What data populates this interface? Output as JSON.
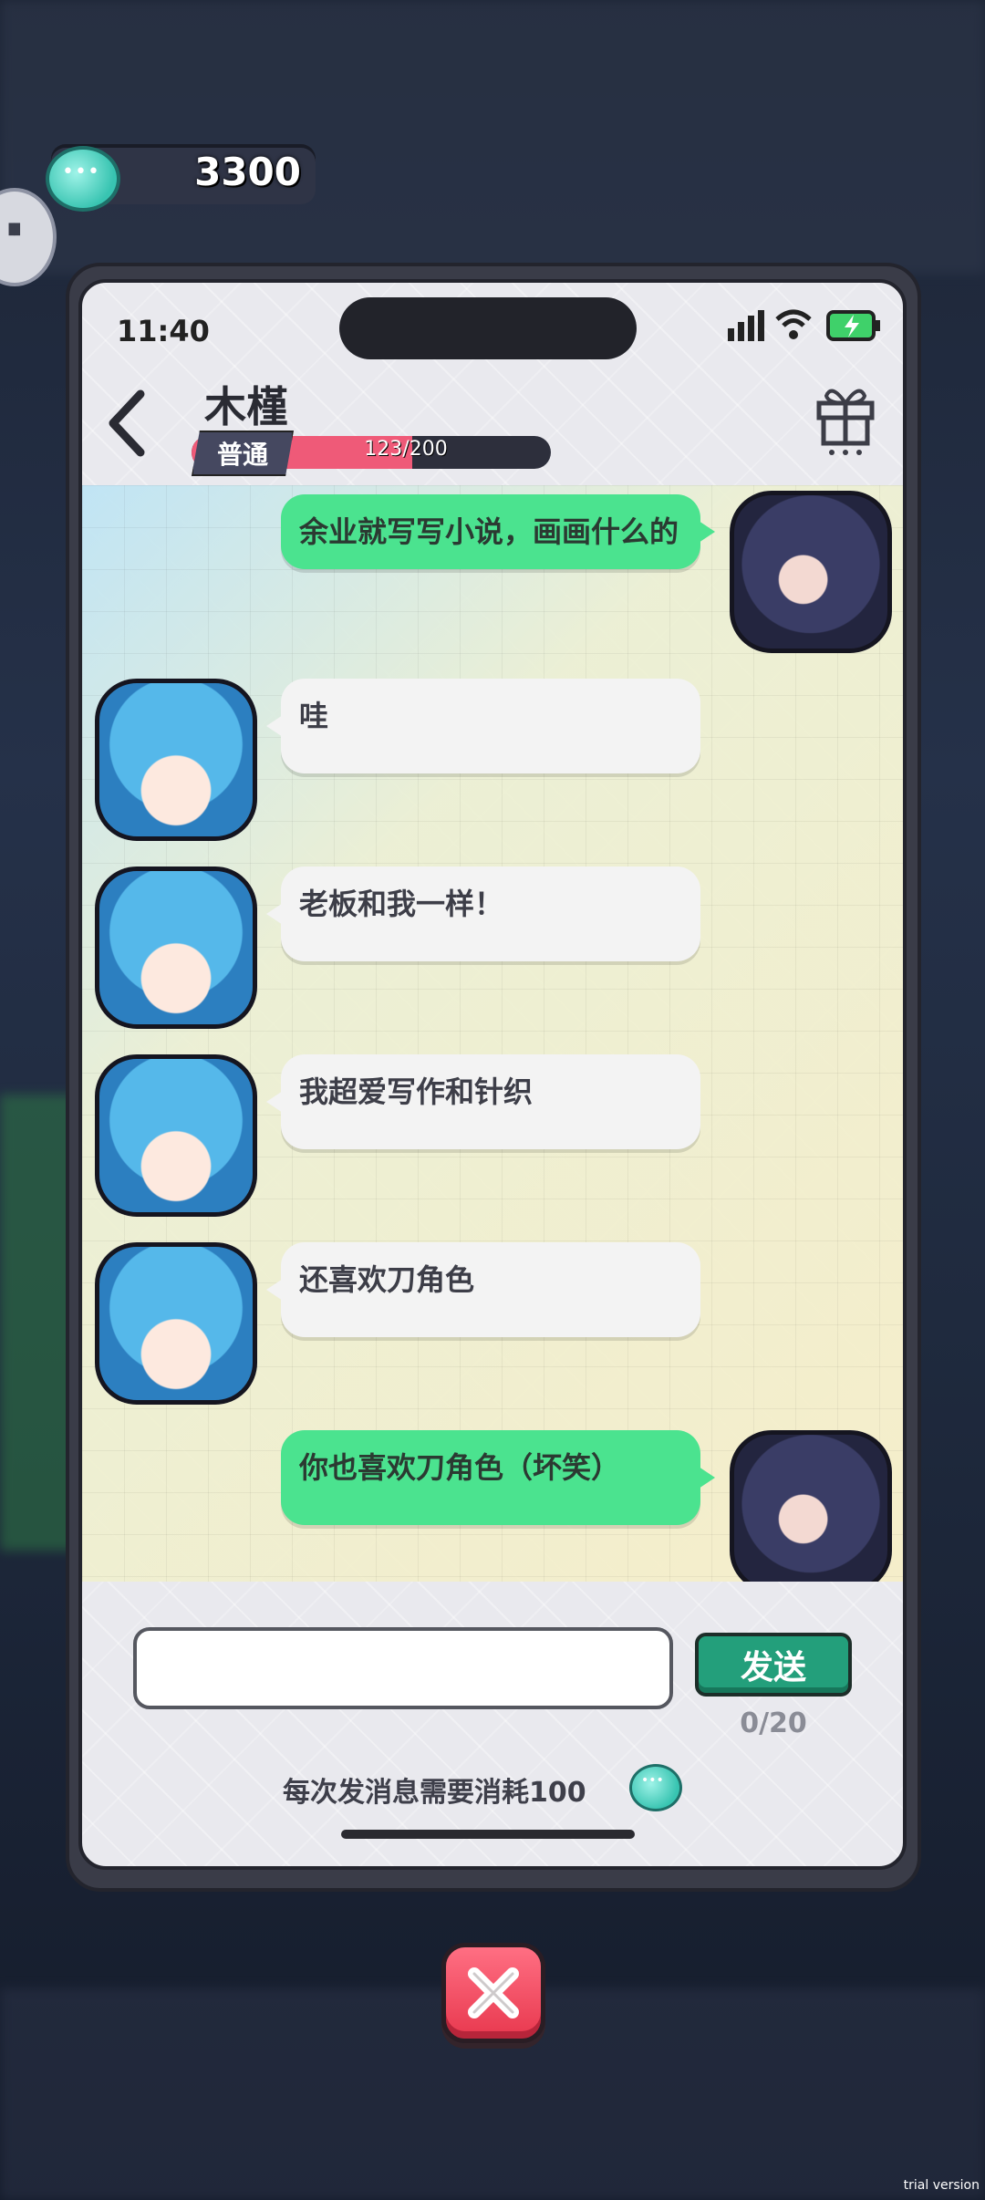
{
  "currency": {
    "amount": "3300"
  },
  "status_bar": {
    "time": "11:40"
  },
  "contact": {
    "name": "木槿",
    "tier": "普通",
    "affinity_text": "123/200",
    "affinity_fraction": 0.615
  },
  "messages": [
    {
      "from": "me",
      "text": "余业就写写小说，画画什么的"
    },
    {
      "from": "them",
      "text": "哇"
    },
    {
      "from": "them",
      "text": "老板和我一样！"
    },
    {
      "from": "them",
      "text": "我超爱写作和针织"
    },
    {
      "from": "them",
      "text": "还喜欢刀角色"
    },
    {
      "from": "me",
      "text": "你也喜欢刀角色（坏笑）"
    }
  ],
  "composer": {
    "placeholder": "",
    "send_label": "发送",
    "char_count": "0/20",
    "cost_note": "每次发消息需要消耗100"
  },
  "watermark": "trial version",
  "colors": {
    "my_bubble": "#4be38f",
    "their_bubble": "#f3f3f3",
    "send_button": "#239f7b",
    "affinity_fill": "#ef5a78",
    "close_button": "#e8384e"
  },
  "icons": [
    "chat-coin-icon",
    "back-icon",
    "gift-icon",
    "signal-icon",
    "wifi-icon",
    "battery-icon",
    "close-icon"
  ]
}
